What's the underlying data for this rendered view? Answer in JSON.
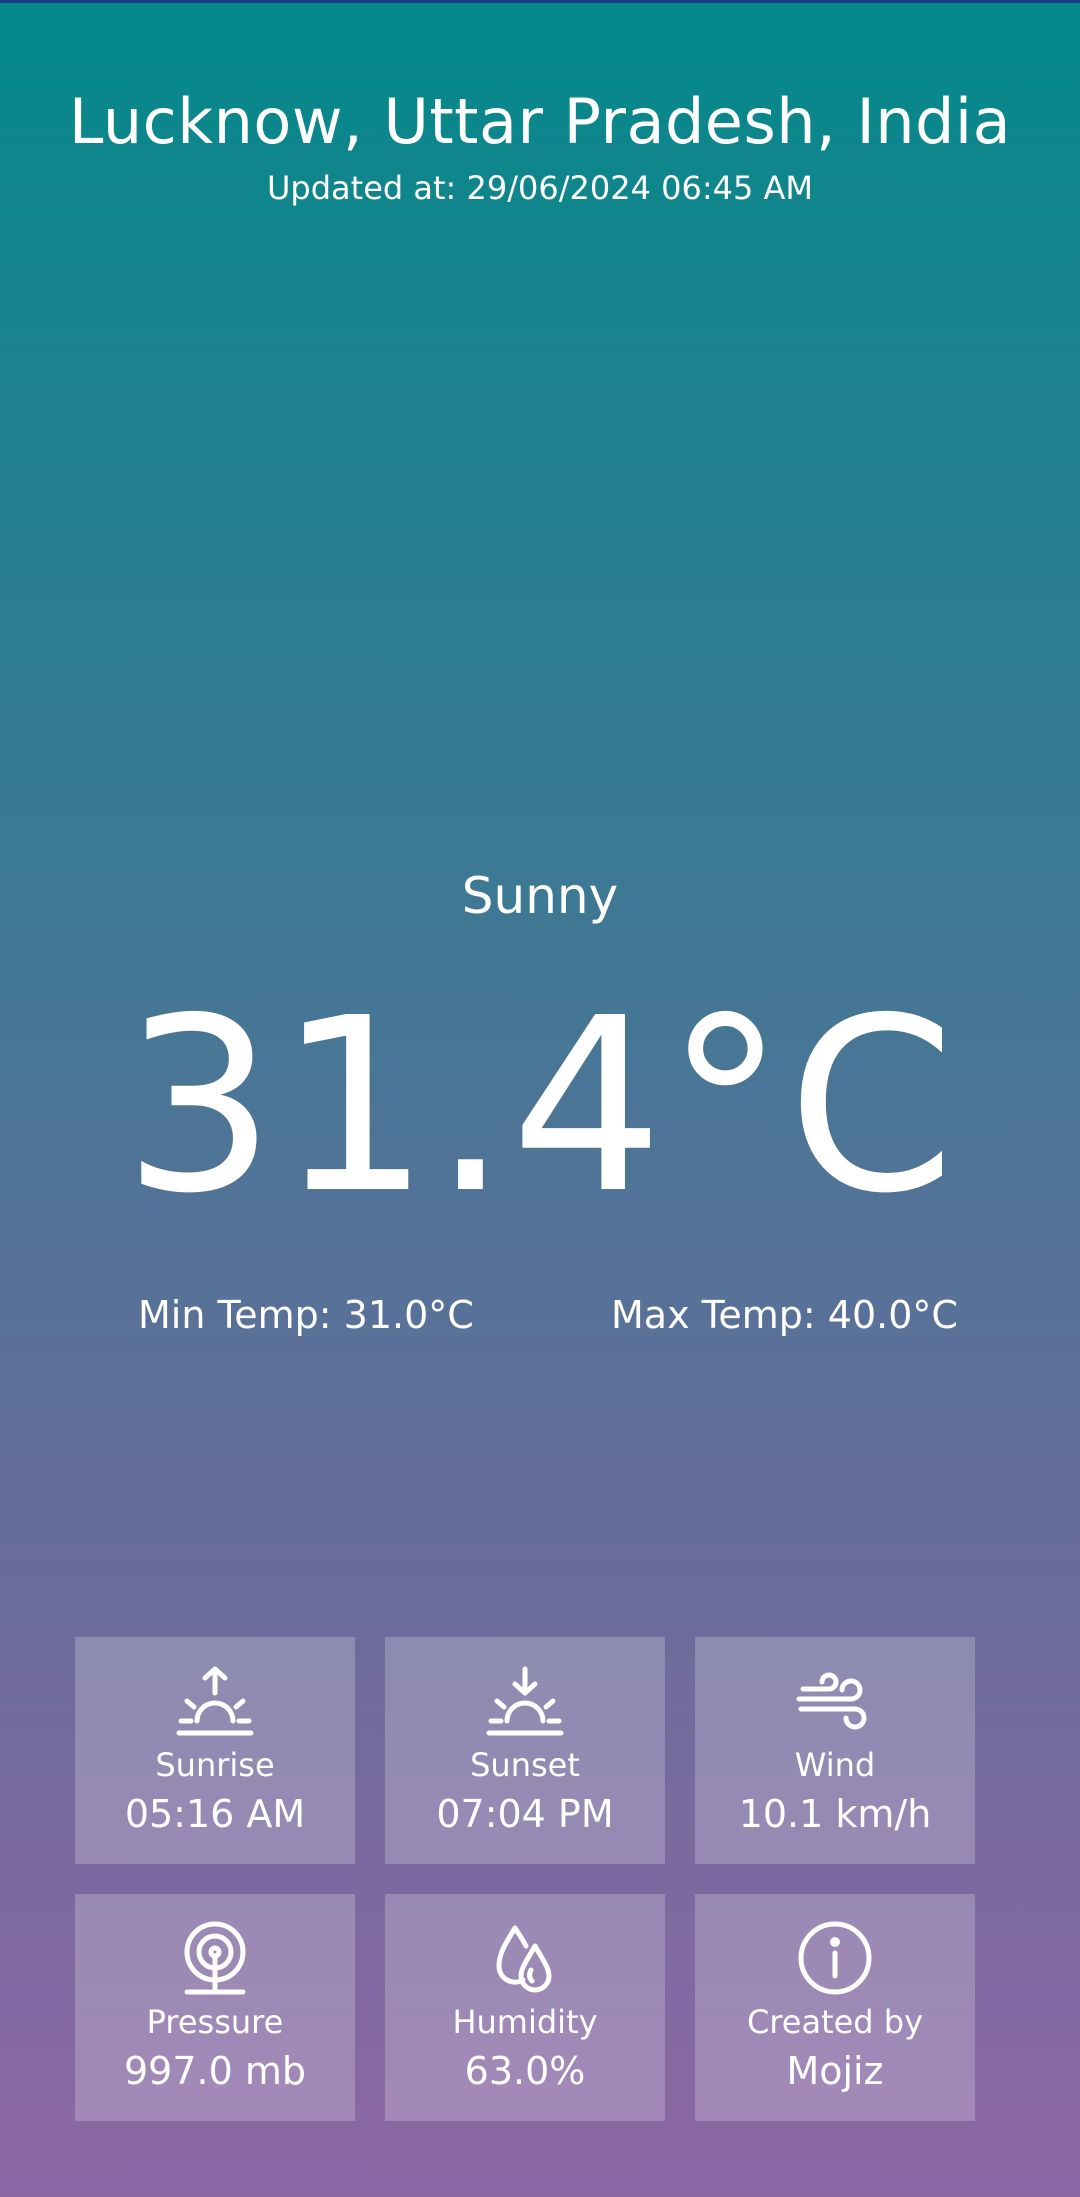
{
  "header": {
    "location": "Lucknow, Uttar Pradesh, India",
    "updated_at": "Updated at: 29/06/2024 06:45 AM"
  },
  "current": {
    "condition": "Sunny",
    "temperature": "31.4°C",
    "min_temp": "Min Temp: 31.0°C",
    "max_temp": "Max Temp: 40.0°C"
  },
  "details": [
    {
      "icon": "sunrise-icon",
      "label": "Sunrise",
      "value": "05:16 AM"
    },
    {
      "icon": "sunset-icon",
      "label": "Sunset",
      "value": "07:04 PM"
    },
    {
      "icon": "wind-icon",
      "label": "Wind",
      "value": "10.1 km/h"
    },
    {
      "icon": "pressure-icon",
      "label": "Pressure",
      "value": "997.0 mb"
    },
    {
      "icon": "humidity-icon",
      "label": "Humidity",
      "value": "63.0%"
    },
    {
      "icon": "info-icon",
      "label": "Created by",
      "value": "Mojiz"
    }
  ],
  "colors": {
    "gradient_top": "#03898a",
    "gradient_bottom": "#8e67a5",
    "card_background": "rgba(255,255,255,0.22)",
    "text": "#ffffff"
  }
}
